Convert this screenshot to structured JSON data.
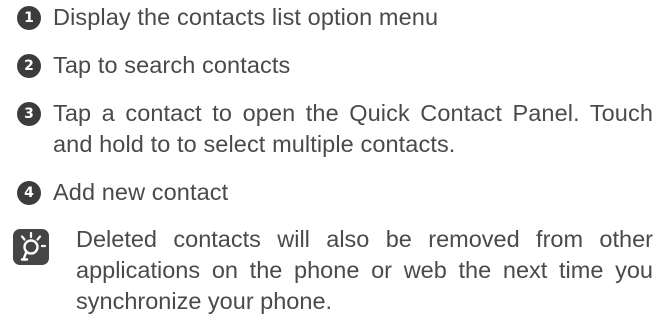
{
  "steps": [
    {
      "number": "1",
      "text": "Display the contacts list option menu"
    },
    {
      "number": "2",
      "text": "Tap to search contacts"
    },
    {
      "number": "3",
      "text": "Tap a contact to open the Quick Contact Panel. Touch and hold to to select multiple contacts."
    },
    {
      "number": "4",
      "text": "Add new contact"
    }
  ],
  "note": {
    "icon": "lightbulb-tip-icon",
    "text": "Deleted contacts will also be removed from other applications on the phone or web the next time you synchronize your phone."
  },
  "colors": {
    "text": "#4a4a4a",
    "badge": "#3c3c3c",
    "badge_text": "#ffffff"
  }
}
